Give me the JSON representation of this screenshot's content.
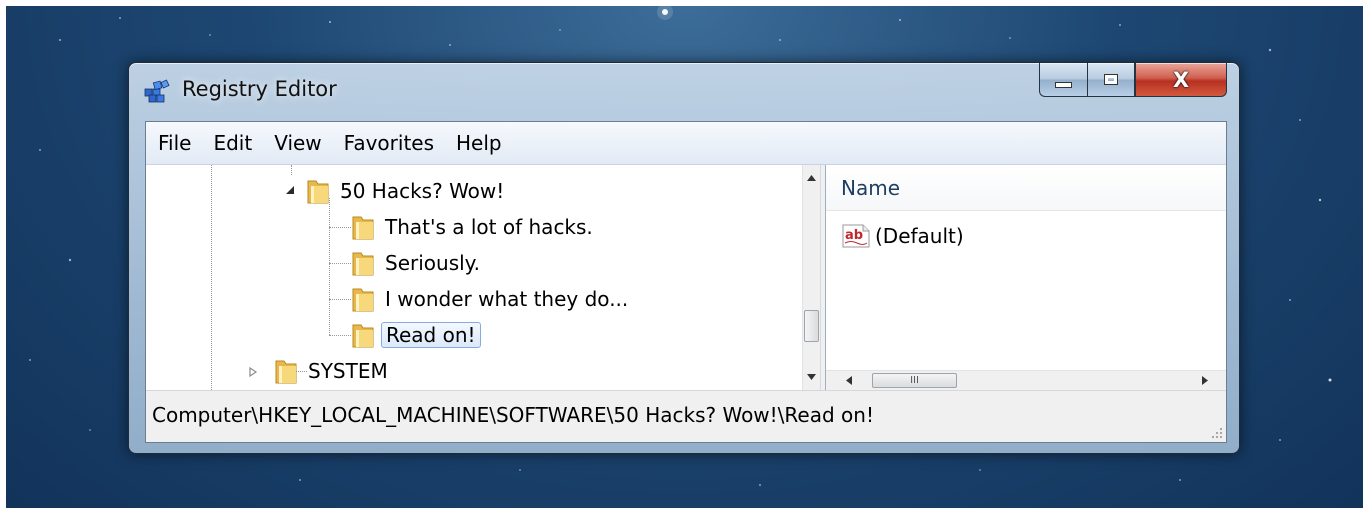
{
  "window": {
    "title": "Registry Editor",
    "close_glyph": "X"
  },
  "menu": [
    "File",
    "Edit",
    "View",
    "Favorites",
    "Help"
  ],
  "tree": {
    "parent": "50 Hacks? Wow!",
    "children": [
      "That's a lot of hacks.",
      "Seriously.",
      "I wonder what they do...",
      "Read on!"
    ],
    "selected": "Read on!",
    "sibling": "SYSTEM"
  },
  "values_pane": {
    "column_name": "Name",
    "rows": [
      {
        "name": "(Default)",
        "icon": "reg-sz-icon"
      }
    ],
    "hscroll_thumb_glyph": "III"
  },
  "status_bar": {
    "path": "Computer\\HKEY_LOCAL_MACHINE\\SOFTWARE\\50 Hacks? Wow!\\Read on!"
  },
  "colors": {
    "desktop": "#1d4772",
    "selection_border": "#84acdd",
    "close_button": "#c0392b"
  }
}
